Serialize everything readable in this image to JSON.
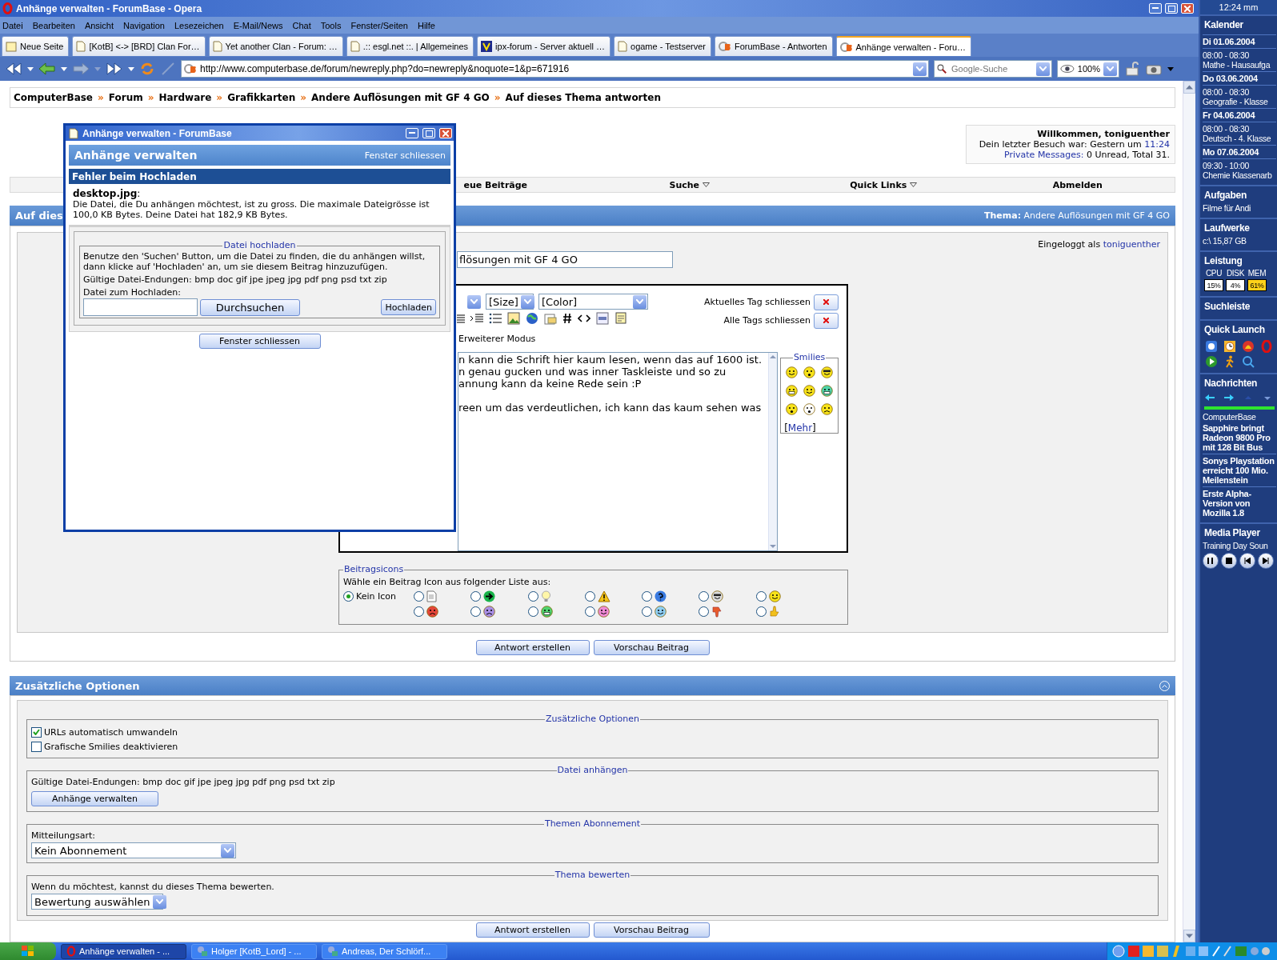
{
  "window": {
    "title": "Anhänge verwalten - ForumBase - Opera"
  },
  "menu": [
    "Datei",
    "Bearbeiten",
    "Ansicht",
    "Navigation",
    "Lesezeichen",
    "E-Mail/News",
    "Chat",
    "Tools",
    "Fenster/Seiten",
    "Hilfe"
  ],
  "tabs": [
    {
      "label": "Neue Seite",
      "kind": "new",
      "selected": false
    },
    {
      "label": "[KotB] <-> [BRD] Clan For…",
      "kind": "page",
      "selected": false
    },
    {
      "label": "Yet another Clan - Forum: …",
      "kind": "page",
      "selected": false
    },
    {
      "label": ".:: esgl.net ::. | Allgemeines",
      "kind": "page",
      "selected": false
    },
    {
      "label": "ipx-forum - Server aktuell …",
      "kind": "ipx",
      "selected": false
    },
    {
      "label": "ogame - Testserver",
      "kind": "page",
      "selected": false
    },
    {
      "label": "ForumBase - Antworten",
      "kind": "cb",
      "selected": false
    },
    {
      "label": "Anhänge verwalten - Foru…",
      "kind": "cb",
      "selected": true
    }
  ],
  "address": {
    "url": "http://www.computerbase.de/forum/newreply.php?do=newreply&noquote=1&p=671916"
  },
  "search": {
    "placeholder": "Google-Suche"
  },
  "zoom": {
    "value": "100%"
  },
  "breadcrumb": [
    {
      "kind": "link",
      "text": "ComputerBase"
    },
    {
      "kind": "separator",
      "text": "»"
    },
    {
      "kind": "link",
      "text": "Forum"
    },
    {
      "kind": "separator",
      "text": "»"
    },
    {
      "kind": "link",
      "text": "Hardware"
    },
    {
      "kind": "separator",
      "text": "»"
    },
    {
      "kind": "link",
      "text": "Grafikkarten"
    },
    {
      "kind": "separator",
      "text": "»"
    },
    {
      "kind": "link",
      "text": "Andere Auflösungen mit GF 4 GO"
    },
    {
      "kind": "separator",
      "text": "»"
    },
    {
      "kind": "current",
      "text": "Auf dieses Thema antworten"
    }
  ],
  "welcome": {
    "title": "Willkommen, toniguenther",
    "last_visit": "Dein letzter Besuch war: Gestern um",
    "last_visit_time": "11:24",
    "pm_label": "Private Messages:",
    "pm_text": "0 Unread, Total 31."
  },
  "navbar": [
    {
      "label": "eue Beiträge",
      "dropdown": false
    },
    {
      "label": "Suche",
      "dropdown": true
    },
    {
      "label": "Quick Links",
      "dropdown": true
    },
    {
      "label": "Abmelden",
      "dropdown": false
    }
  ],
  "reply_header": {
    "title": "Auf dies",
    "thema_label": "Thema:",
    "thema": "Andere Auflösungen mit GF 4 GO"
  },
  "logged_in": {
    "label": "Eingeloggt als",
    "user": "toniguenther"
  },
  "subject": {
    "value": "flösungen mit GF 4 GO"
  },
  "editor": {
    "selects": [
      "[Size]",
      "[Color]"
    ],
    "close_current": "Aktuelles Tag schliessen",
    "close_all": "Alle Tags schliessen",
    "mode": "Erweiterer Modus",
    "message": "n kann die Schrift hier kaum lesen, wenn das auf 1600 ist.\nn genau gucken und was inner Taskleiste und so zu\nannung kann da keine Rede sein :P\n\nreen um das verdeutlichen, ich kann das kaum sehen was",
    "smilies": {
      "title": "Smilies",
      "open": "[",
      "more": "Mehr",
      "close": "]"
    }
  },
  "post_icons": {
    "title": "Beitragsicons",
    "prompt": "Wähle ein Beitrag Icon aus folgender Liste aus:",
    "options": [
      {
        "label": "Kein Icon",
        "selected": true
      },
      {
        "selected": false
      },
      {
        "selected": false
      },
      {
        "selected": false
      },
      {
        "selected": false
      },
      {
        "selected": false
      },
      {
        "selected": false
      },
      {
        "selected": false
      },
      {
        "selected": false
      },
      {
        "selected": false
      },
      {
        "selected": false
      },
      {
        "selected": false
      },
      {
        "selected": false
      },
      {
        "selected": false
      },
      {
        "selected": false
      }
    ]
  },
  "buttons": [
    "Antwort erstellen",
    "Vorschau Beitrag"
  ],
  "options": {
    "title": "Zusätzliche Optionen",
    "misc": {
      "legend": "Zusätzliche Optionen",
      "checkboxes": [
        {
          "label": "URLs automatisch umwandeln",
          "checked": true
        },
        {
          "label": "Grafische Smilies deaktivieren",
          "checked": false
        }
      ]
    },
    "attach": {
      "legend": "Datei anhängen",
      "text": "Gültige Datei-Endungen: bmp doc gif jpe jpeg jpg pdf png psd txt zip",
      "button": "Anhänge verwalten"
    },
    "subscribe": {
      "legend": "Themen Abonnement",
      "label": "Mitteilungsart:",
      "value": "Kein Abonnement"
    },
    "rate": {
      "legend": "Thema bewerten",
      "text": "Wenn du möchtest, kannst du dieses Thema bewerten.",
      "value": "Bewertung auswählen"
    },
    "buttons": [
      "Antwort erstellen",
      "Vorschau Beitrag"
    ]
  },
  "popup": {
    "title": "Anhänge verwalten - ForumBase",
    "header": "Anhänge verwalten",
    "close_link": "Fenster schliessen",
    "error_title": "Fehler beim Hochladen",
    "error_file": "**desktop.jpg**:",
    "error_text": "Die Datei, die Du anhängen möchtest, ist zu gross. Die maximale Dateigrösse ist 100,0 KB Bytes. Deine Datei hat 182,9 KB Bytes.",
    "upload": {
      "legend": "Datei hochladen",
      "help": "Benutze den 'Suchen' Button, um die Datei zu finden, die du anhängen willst, dann klicke auf 'Hochladen' an, um sie diesem Beitrag hinzuzufügen.",
      "extensions": "Gültige Datei-Endungen: bmp doc gif jpe jpeg jpg pdf png psd txt zip",
      "file_label": "Datei zum Hochladen:",
      "browse": "Durchsuchen",
      "upload": "Hochladen"
    },
    "close_button": "Fenster schliessen"
  },
  "sidebar": {
    "clock": "12:24 mm",
    "panels": [
      {
        "kind": "calendar",
        "title": "Kalender",
        "entries": [
          {
            "date": "Di 01.06.2004",
            "time": "08:00 - 08:30",
            "text": "Mathe - Hausaufga"
          },
          {
            "date": "Do 03.06.2004",
            "time": "08:00 - 08:30",
            "text": "Geografie - Klasse"
          },
          {
            "date": "Fr 04.06.2004",
            "time": "08:00 - 08:30",
            "text": "Deutsch - 4. Klasse"
          },
          {
            "date": "Mo 07.06.2004",
            "time": "09:30 - 10:00",
            "text": "Chemie Klassenarb"
          }
        ]
      },
      {
        "kind": "list",
        "title": "Aufgaben",
        "items": [
          "Filme für Andi"
        ]
      },
      {
        "kind": "list",
        "title": "Laufwerke",
        "items": [
          "c:\\ 15,87 GB"
        ]
      },
      {
        "kind": "meters",
        "title": "Leistung",
        "meters": [
          {
            "label": "CPU",
            "reading": "15%",
            "warning": false
          },
          {
            "label": "DISK",
            "reading": "4%",
            "warning": false
          },
          {
            "label": "MEM",
            "reading": "61%",
            "warning": true
          }
        ]
      },
      {
        "kind": "plain",
        "title": "Suchleiste"
      },
      {
        "kind": "launch",
        "title": "Quick Launch"
      },
      {
        "kind": "news",
        "title": "Nachrichten",
        "source": "ComputerBase",
        "headlines": [
          "Sapphire bringt Radeon 9800 Pro mit 128 Bit Bus",
          "Sonys Playstation erreicht 100 Mio. Meilenstein",
          "Erste Alpha-Version von Mozilla 1.8"
        ]
      },
      {
        "kind": "player",
        "title": "Media Player",
        "track": "Training Day Soun"
      }
    ]
  },
  "taskbar": {
    "tasks": [
      {
        "label": "Anhänge verwalten - ...",
        "kind": "opera",
        "selected": true
      },
      {
        "label": "Holger [KotB_Lord] - ...",
        "kind": "chat",
        "selected": false
      },
      {
        "label": "Andreas, Der Schlörf...",
        "kind": "chat",
        "selected": false
      }
    ]
  }
}
